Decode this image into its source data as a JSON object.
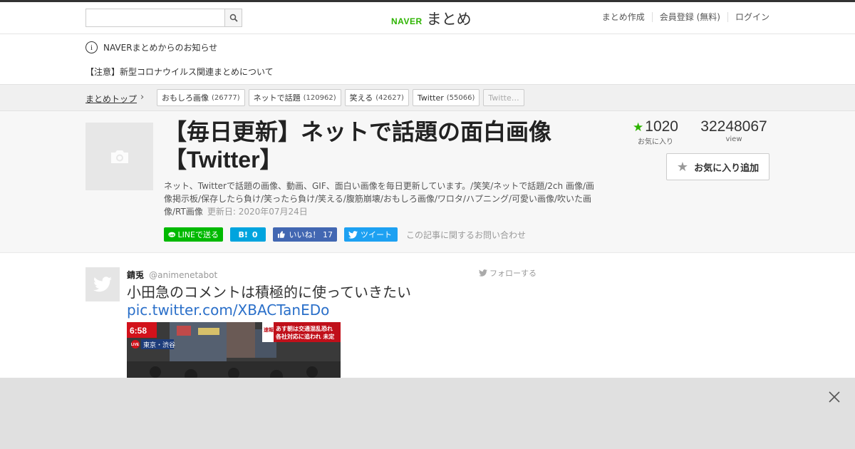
{
  "header": {
    "search_placeholder": "",
    "logo_naver": "NAVER",
    "logo_matome": "まとめ",
    "nav": [
      "まとめ作成",
      "会員登録 (無料)",
      "ログイン"
    ]
  },
  "notice": {
    "title": "NAVERまとめからのお知らせ",
    "link": "【注意】新型コロナウイルス関連まとめについて"
  },
  "breadcrumb": {
    "home": "まとめトップ",
    "tags": [
      {
        "label": "おもしろ画像",
        "count": "(26777)"
      },
      {
        "label": "ネットで話題",
        "count": "(120962)"
      },
      {
        "label": "笑える",
        "count": "(42627)"
      },
      {
        "label": "Twitter",
        "count": "(55066)"
      },
      {
        "label": "Twitte…",
        "count": ""
      }
    ]
  },
  "article": {
    "title": "【毎日更新】ネットで話題の面白画像【Twitter】",
    "description": "ネット、Twitterで話題の画像、動画、GIF、面白い画像を毎日更新しています。/笑笑/ネットで話題/2ch 画像/画像掲示板/保存したら負け/笑ったら負け/笑える/腹筋崩壊/おもしろ画像/ワロタ/ハプニング/可愛い画像/吹いた画像/RT画像",
    "updated": "更新日: 2020年07月24日",
    "favorites": "1020",
    "favorites_label": "お気に入り",
    "views": "32248067",
    "views_label": "view",
    "fav_button": "お気に入り追加",
    "share": {
      "line": "LINEで送る",
      "hatena": "0",
      "facebook": "いいね！ 17",
      "twitter": "ツイート",
      "inquiry": "この記事に関するお問い合わせ"
    }
  },
  "tweet": {
    "name": "錆兎",
    "handle": "@animenetabot",
    "follow": "フォローする",
    "text": "小田急のコメントは積極的に使っていきたい",
    "link": "pic.twitter.com/XBACTanEDo",
    "image": {
      "time": "6:58",
      "live": "LIVE",
      "location": "東京・渋谷",
      "breaking": "速報",
      "headline1": "あす朝は交通混乱恐れ",
      "headline2": "各社対応に追われ 未定"
    }
  },
  "colors": {
    "naver_green": "#2db400",
    "line_green": "#00b900",
    "hatena_blue": "#00a4de",
    "facebook_blue": "#4267b2",
    "twitter_blue": "#1da1f2",
    "link_blue": "#2a6fc9"
  }
}
